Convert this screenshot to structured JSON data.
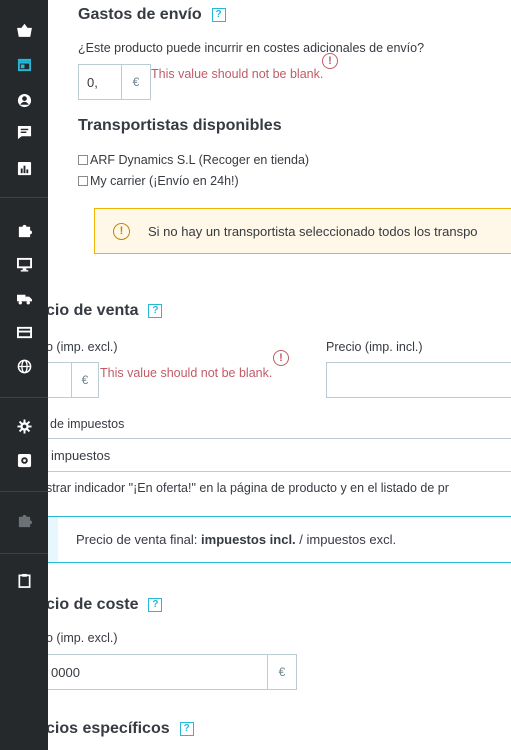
{
  "sidebar": {
    "icons": [
      "basket-icon",
      "store-icon",
      "user-icon",
      "chat-icon",
      "stats-icon",
      "puzzle-icon",
      "monitor-icon",
      "truck-icon",
      "card-icon",
      "globe-icon",
      "gear-icon",
      "settings-box-icon",
      "puzzle-dim-icon",
      "clipboard-icon"
    ]
  },
  "shipping": {
    "title": "Gastos de envío",
    "help": "?",
    "question": "¿Este producto puede incurrir en costes adicionales de envío?",
    "value": "0,",
    "currency": "€",
    "error_icon": "!",
    "error": "This value should not be blank."
  },
  "carriers": {
    "title": "Transportistas disponibles",
    "items": [
      "ARF Dynamics S.L (Recoger en tienda)",
      "My carrier (¡Envío en 24h!)"
    ],
    "warning_icon": "!",
    "warning": "Si no hay un transportista seleccionado todos los transpo"
  },
  "sale_price": {
    "title": "cio de venta",
    "help": "?",
    "excl_label": "o (imp. excl.)",
    "incl_label": "Precio (imp. incl.)",
    "currency": "€",
    "error_icon": "!",
    "error": "This value should not be blank.",
    "tax_label": "de impuestos",
    "tax_value": "impuestos",
    "onsale_label": "strar indicador \"¡En oferta!\" en la página de producto y en el listado de pr",
    "final_prefix": "Precio de venta final: ",
    "final_bold": "impuestos incl.",
    "final_suffix": " / impuestos excl."
  },
  "cost_price": {
    "title": "cio de coste",
    "help": "?",
    "label": "o (imp. excl.)",
    "value": "0000",
    "currency": "€"
  },
  "specific": {
    "title": "cios específicos",
    "help": "?"
  }
}
